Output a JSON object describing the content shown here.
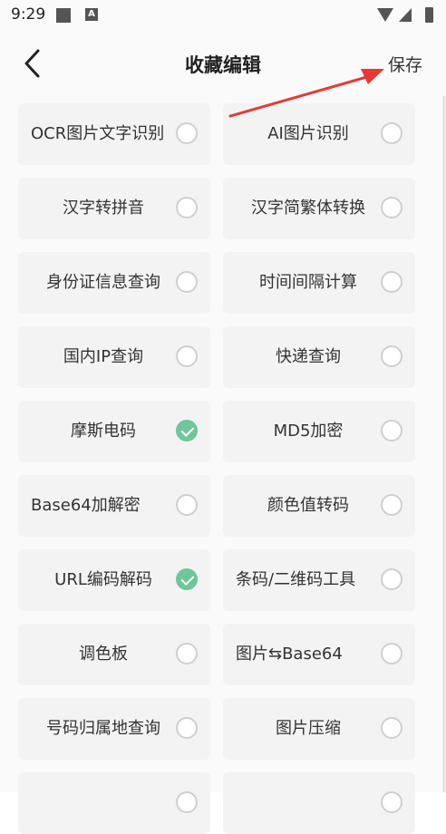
{
  "status": {
    "time": "9:29",
    "notif_icon_letter": "A"
  },
  "header": {
    "title": "收藏编辑",
    "save_label": "保存"
  },
  "items": [
    {
      "label": "OCR图片文字识别",
      "checked": false
    },
    {
      "label": "AI图片识别",
      "checked": false
    },
    {
      "label": "汉字转拼音",
      "checked": false
    },
    {
      "label": "汉字简繁体转换",
      "checked": false
    },
    {
      "label": "身份证信息查询",
      "checked": false
    },
    {
      "label": "时间间隔计算",
      "checked": false
    },
    {
      "label": "国内IP查询",
      "checked": false
    },
    {
      "label": "快递查询",
      "checked": false
    },
    {
      "label": "摩斯电码",
      "checked": true
    },
    {
      "label": "MD5加密",
      "checked": false
    },
    {
      "label": "Base64加解密",
      "checked": false
    },
    {
      "label": "颜色值转码",
      "checked": false
    },
    {
      "label": "URL编码解码",
      "checked": true
    },
    {
      "label": "条码/二维码工具",
      "checked": false
    },
    {
      "label": "调色板",
      "checked": false
    },
    {
      "label": "图片⇆Base64",
      "checked": false
    },
    {
      "label": "号码归属地查询",
      "checked": false
    },
    {
      "label": "图片压缩",
      "checked": false
    },
    {
      "label": "",
      "checked": false
    },
    {
      "label": "",
      "checked": false
    }
  ],
  "colors": {
    "checked": "#6fc69a",
    "annotation_arrow": "#e53935"
  }
}
